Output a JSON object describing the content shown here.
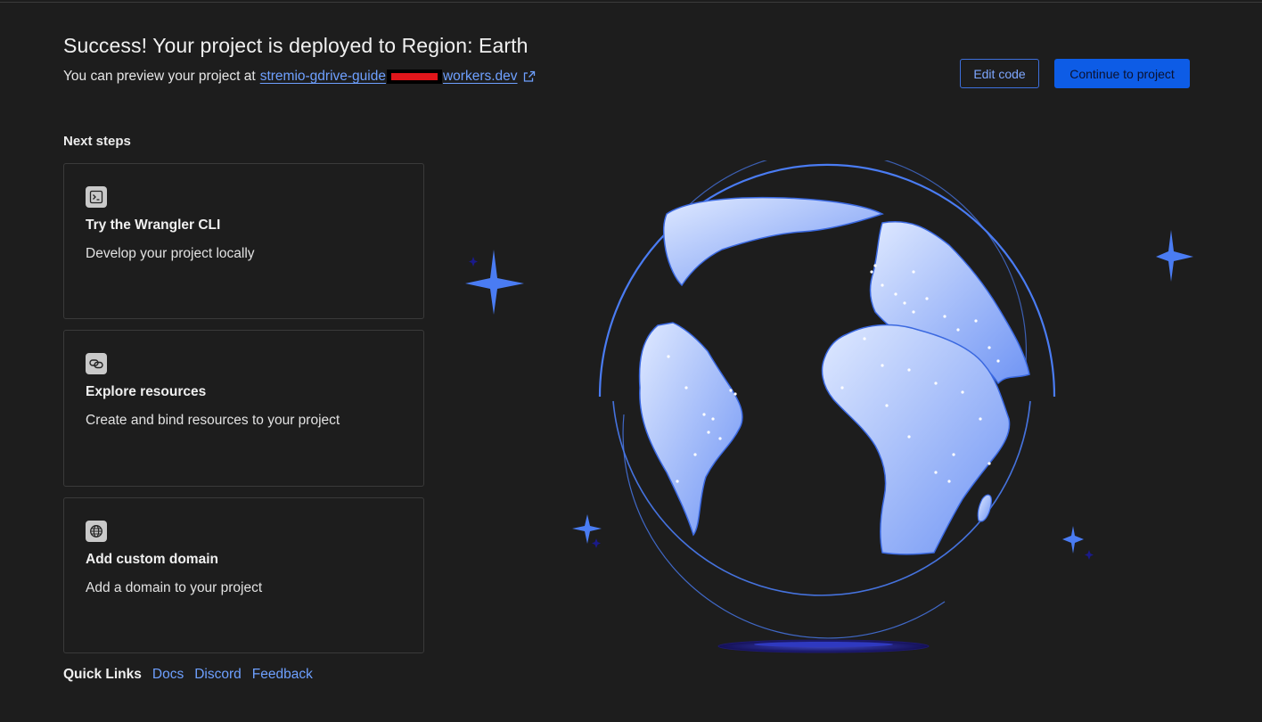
{
  "header": {
    "title": "Success! Your project is deployed to Region: Earth",
    "preview_prefix": "You can preview your project at",
    "preview_link_start": "stremio-gdrive-guide",
    "preview_link_end": "workers.dev"
  },
  "actions": {
    "edit_label": "Edit code",
    "continue_label": "Continue to project"
  },
  "next_steps": {
    "heading": "Next steps",
    "cards": [
      {
        "title": "Try the Wrangler CLI",
        "description": "Develop your project locally",
        "icon": "terminal-icon"
      },
      {
        "title": "Explore resources",
        "description": "Create and bind resources to your project",
        "icon": "link-icon"
      },
      {
        "title": "Add custom domain",
        "description": "Add a domain to your project",
        "icon": "globe-icon"
      }
    ]
  },
  "quick_links": {
    "label": "Quick Links",
    "docs": "Docs",
    "discord": "Discord",
    "feedback": "Feedback"
  },
  "colors": {
    "background": "#1d1d1d",
    "accent": "#0d5ce6",
    "link": "#6ea0ff",
    "globe_fill": "#a9c3ff",
    "sparkle": "#4a7cf3"
  }
}
